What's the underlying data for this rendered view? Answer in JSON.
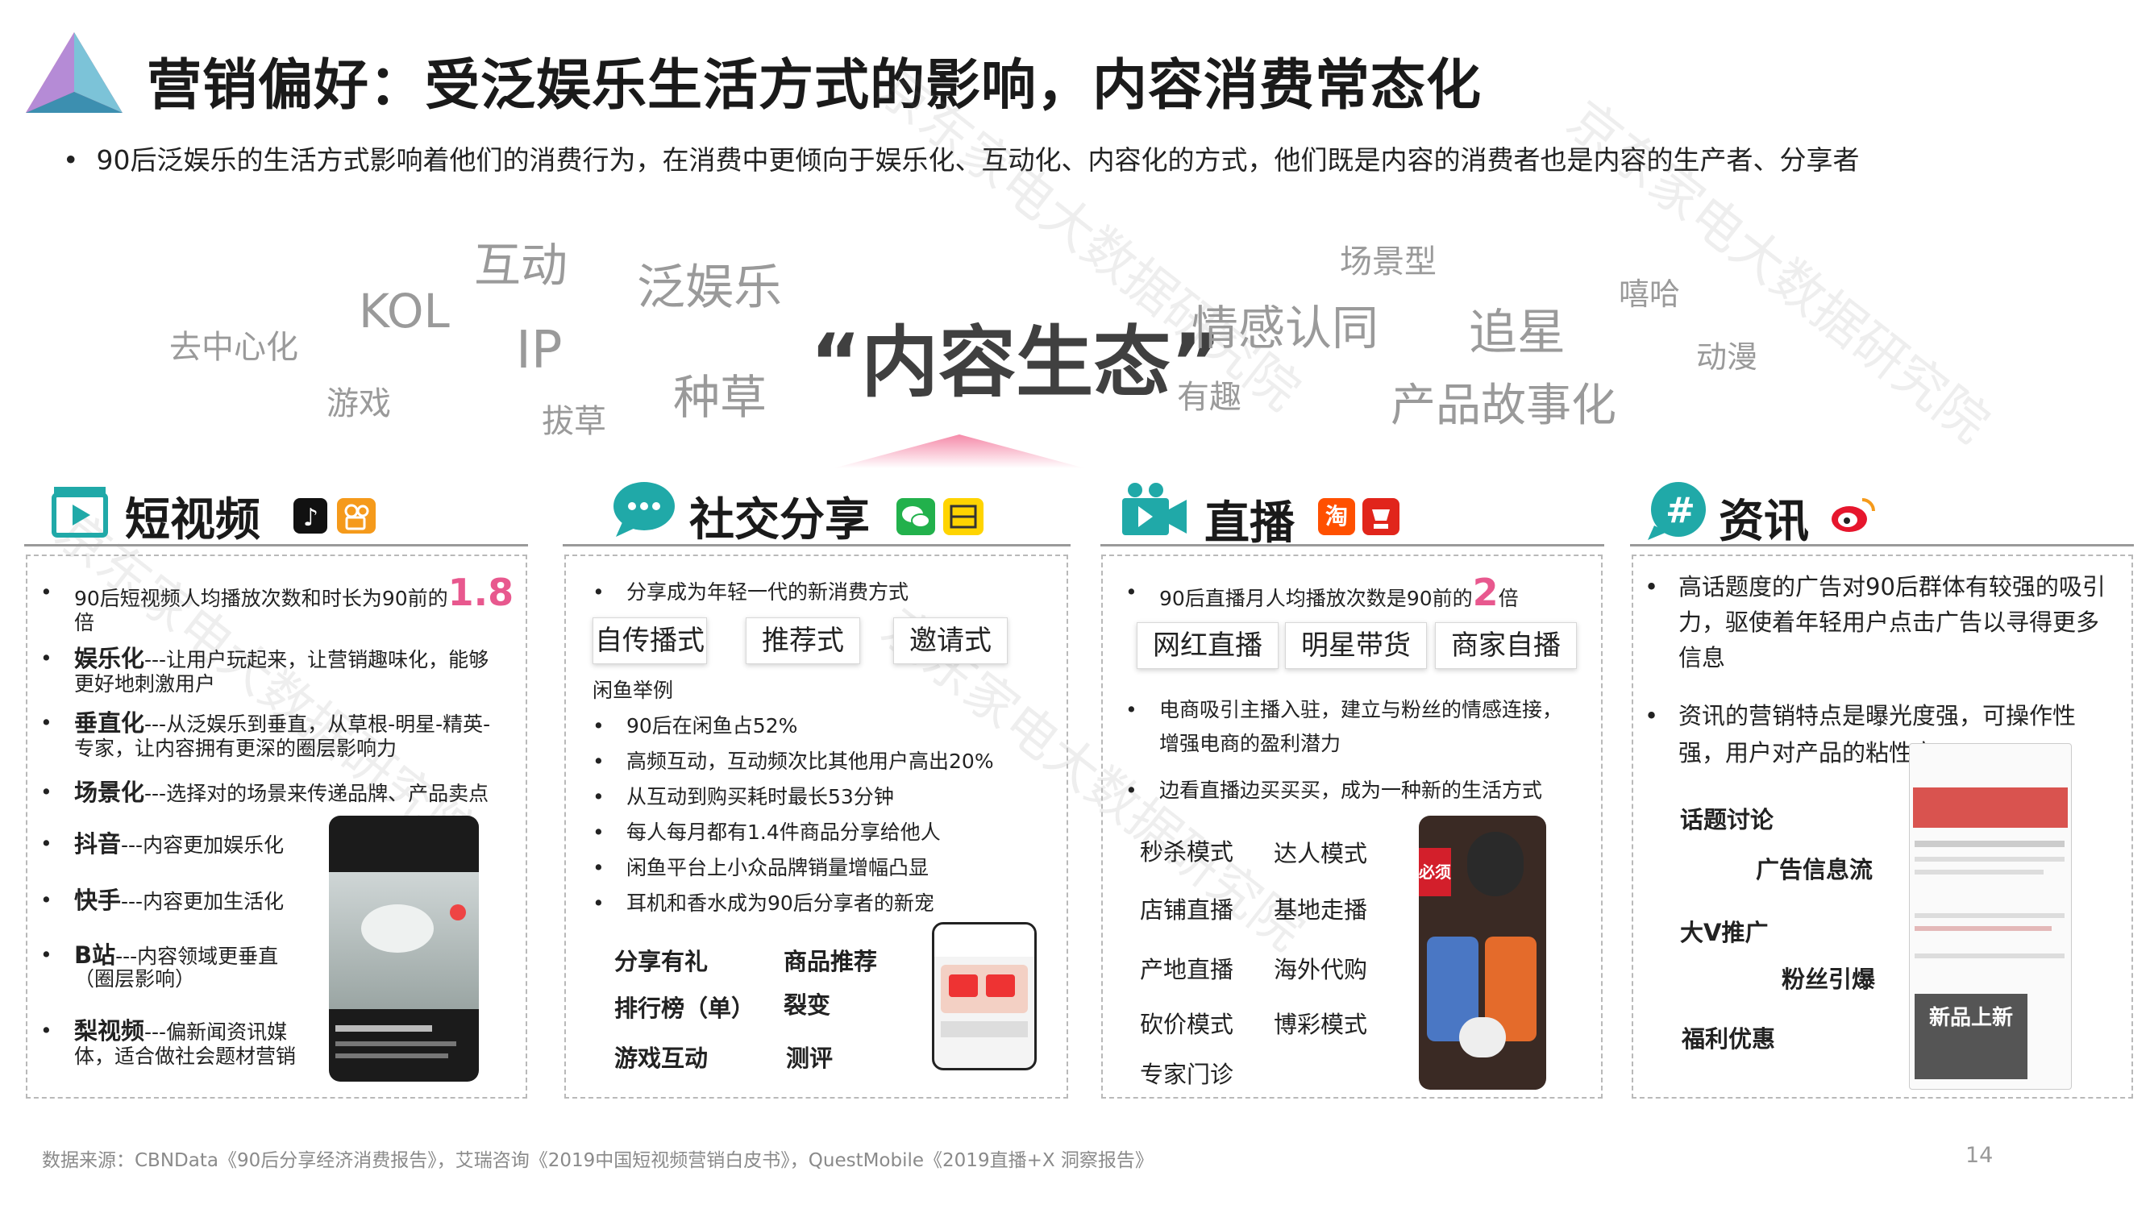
{
  "header": {
    "title": "营销偏好：受泛娱乐生活方式的影响，内容消费常态化",
    "subtitle": "90后泛娱乐的生活方式影响着他们的消费行为，在消费中更倾向于娱乐化、互动化、内容化的方式，他们既是内容的消费者也是内容的生产者、分享者"
  },
  "watermark": "京东家电大数据研究院",
  "word_cloud": {
    "center": "“内容生态”",
    "words": [
      "互动",
      "泛娱乐",
      "KOL",
      "去中心化",
      "IP",
      "游戏",
      "拔草",
      "种草",
      "情感认同",
      "场景型",
      "有趣",
      "追星",
      "产品故事化",
      "嘻哈",
      "动漫"
    ]
  },
  "sections": {
    "short_video": {
      "title": "短视频",
      "b1_prefix": "90后短视频人均播放次数和时长为90前的",
      "b1_num": "1.8",
      "b1_suffix": "倍",
      "b2_bold": "娱乐化",
      "b2_text": "---让用户玩起来，让营销趣味化，能够",
      "b2_text2": "更好地刺激用户",
      "b3_bold": "垂直化",
      "b3_text": "---从泛娱乐到垂直，从草根-明星-精英-",
      "b3_text2": "专家，让内容拥有更深的圈层影响力",
      "b4_bold": "场景化",
      "b4_text": "---选择对的场景来传递品牌、产品卖点",
      "b5_bold": "抖音",
      "b5_text": "---内容更加娱乐化",
      "b6_bold": "快手",
      "b6_text": "---内容更加生活化",
      "b7_bold": "B站",
      "b7_text": "---内容领域更垂直",
      "b7_text2": "（圈层影响）",
      "b8_bold": "梨视频",
      "b8_text": "---偏新闻资讯媒",
      "b8_text2": "体，适合做社会题材营销"
    },
    "social": {
      "title": "社交分享",
      "b1": "分享成为年轻一代的新消费方式",
      "tags": [
        "自传播式",
        "推荐式",
        "邀请式"
      ],
      "example_label": "闲鱼举例",
      "items": [
        "90后在闲鱼占52%",
        "高频互动，互动频次比其他用户高出20%",
        "从互动到购买耗时最长53分钟",
        "每人每月都有1.4件商品分享给他人",
        "闲鱼平台上小众品牌销量增幅凸显",
        "耳机和香水成为90后分享者的新宠"
      ],
      "modes": [
        "分享有礼",
        "商品推荐",
        "排行榜（单）",
        "裂变",
        "游戏互动",
        "测评"
      ]
    },
    "live": {
      "title": "直播",
      "b1_prefix": "90后直播月人均播放次数是90前的",
      "b1_num": "2",
      "b1_suffix": "倍",
      "tags": [
        "网红直播",
        "明星带货",
        "商家自播"
      ],
      "b2": "电商吸引主播入驻，建立与粉丝的情感连接，",
      "b2_2": "增强电商的盈利潜力",
      "b3": "边看直播边买买买，成为一种新的生活方式",
      "modes": [
        "秒杀模式",
        "达人模式",
        "店铺直播",
        "基地走播",
        "产地直播",
        "海外代购",
        "砍价模式",
        "博彩模式",
        "专家门诊"
      ],
      "phone_text": "必须抢！"
    },
    "news": {
      "title": "资讯",
      "b1": "高话题度的广告对90后群体有较强的吸引",
      "b1_2": "力，驱使着年轻用户点击广告以寻得更多",
      "b1_3": "信息",
      "b2": "资讯的营销特点是曝光度强，可操作性",
      "b2_2": "强，用户对产品的粘性高",
      "modes": [
        "话题讨论",
        "广告信息流",
        "大V推广",
        "粉丝引爆",
        "福利优惠"
      ],
      "phone_text": "新品上新"
    }
  },
  "platform_icons": {
    "short_video": [
      "tiktok-icon",
      "kuaishou-icon"
    ],
    "social": [
      "wechat-icon",
      "xianyu-icon"
    ],
    "live": [
      "taobao-icon",
      "jd-icon"
    ],
    "news": [
      "weibo-icon"
    ]
  },
  "footer": {
    "source": "数据来源：CBNData《90后分享经济消费报告》，艾瑞咨询《2019中国短视频营销白皮书》，QuestMobile《2019直播+X 洞察报告》",
    "page": "14"
  },
  "colors": {
    "accent_pink": "#e8588e",
    "icon_teal": "#20a9a8",
    "text_dark": "#1a1a1a"
  }
}
